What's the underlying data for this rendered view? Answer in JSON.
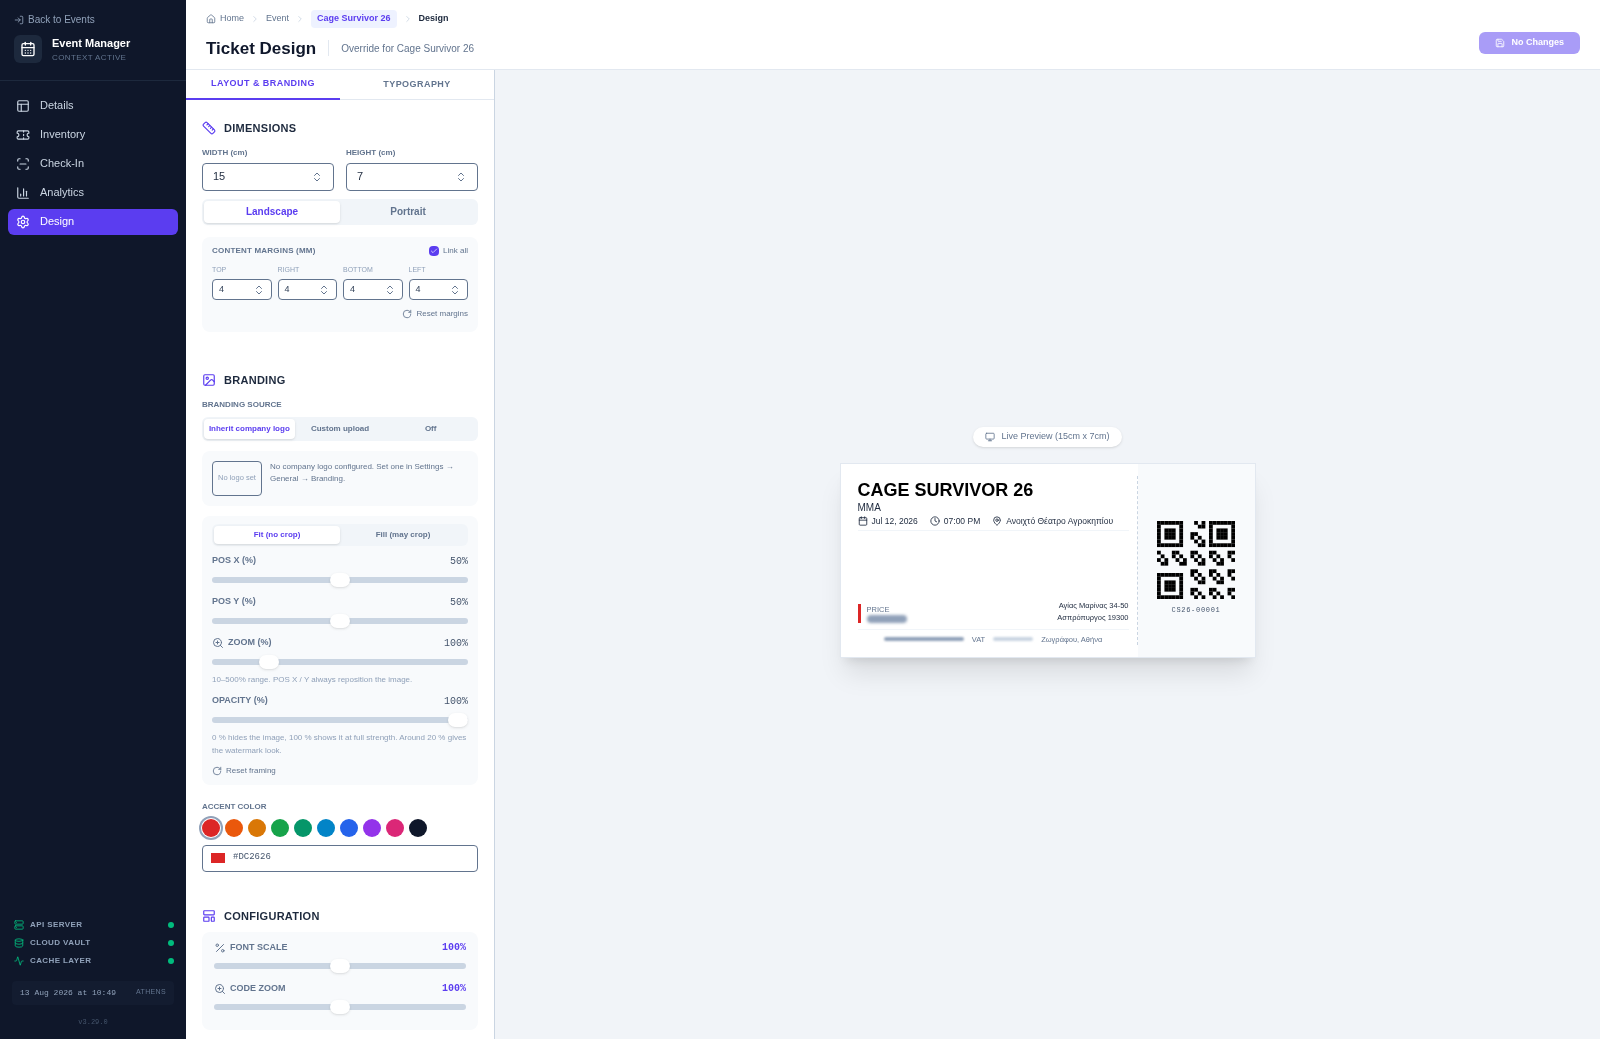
{
  "sidebar": {
    "back_link": "Back to Events",
    "app_title": "Event Manager",
    "app_subtitle": "CONTEXT ACTIVE",
    "nav": [
      {
        "label": "Details",
        "selected": false
      },
      {
        "label": "Inventory",
        "selected": false
      },
      {
        "label": "Check-In",
        "selected": false
      },
      {
        "label": "Analytics",
        "selected": false
      },
      {
        "label": "Design",
        "selected": true
      }
    ],
    "services": [
      {
        "label": "API SERVER",
        "online": true
      },
      {
        "label": "CLOUD VAULT",
        "online": true
      },
      {
        "label": "CACHE LAYER",
        "online": true
      }
    ],
    "clock": {
      "datetime": "13 Aug 2026 at 10:49",
      "city": "ATHENS"
    },
    "version": "v3.29.0"
  },
  "header": {
    "breadcrumbs": [
      {
        "label": "Home",
        "kind": "home"
      },
      {
        "label": "Event",
        "kind": "link"
      },
      {
        "label": "Cage Survivor 26",
        "kind": "highlight"
      },
      {
        "label": "Design",
        "kind": "current"
      }
    ],
    "title": "Ticket Design",
    "subtitle": "Override for Cage Survivor 26",
    "save_button": {
      "label": "No Changes",
      "disabled": true
    }
  },
  "tabs": [
    {
      "label": "LAYOUT & BRANDING",
      "selected": true
    },
    {
      "label": "TYPOGRAPHY",
      "selected": false
    }
  ],
  "dimensions": {
    "title": "DIMENSIONS",
    "fields": [
      {
        "label": "WIDTH (cm)",
        "value": "15"
      },
      {
        "label": "HEIGHT (cm)",
        "value": "7"
      }
    ],
    "orientation": [
      {
        "label": "Landscape",
        "selected": true
      },
      {
        "label": "Portrait",
        "selected": false
      }
    ],
    "margins": {
      "title": "CONTENT MARGINS (MM)",
      "link_all": {
        "label": "Link all",
        "checked": true
      },
      "fields": [
        {
          "label": "TOP",
          "value": "4"
        },
        {
          "label": "RIGHT",
          "value": "4"
        },
        {
          "label": "BOTTOM",
          "value": "4"
        },
        {
          "label": "LEFT",
          "value": "4"
        }
      ],
      "reset": "Reset margins"
    }
  },
  "branding": {
    "title": "BRANDING",
    "source_label": "BRANDING SOURCE",
    "sources": [
      {
        "label": "Inherit company logo",
        "selected": true
      },
      {
        "label": "Custom upload",
        "selected": false
      },
      {
        "label": "Off",
        "selected": false
      }
    ],
    "logo_placeholder": "No logo set",
    "message": "No company logo configured. Set one in Settings → General → Branding.",
    "fit_modes": [
      {
        "label": "Fit (no crop)",
        "selected": true
      },
      {
        "label": "Fill (may crop)",
        "selected": false
      }
    ],
    "sliders": [
      {
        "label": "POS X (%)",
        "value": "50%",
        "level": 0.5,
        "kind": "plain"
      },
      {
        "label": "POS Y (%)",
        "value": "50%",
        "level": 0.5,
        "kind": "plain"
      },
      {
        "label": "ZOOM (%)",
        "value": "100%",
        "level": 0.2,
        "kind": "zoom",
        "hint": "10–500% range. POS X / Y always reposition the image."
      },
      {
        "label": "OPACITY (%)",
        "value": "100%",
        "level": 1,
        "kind": "plain",
        "hint": "0 % hides the image, 100 % shows it at full strength. Around 20 % gives the watermark look."
      }
    ],
    "reset": "Reset framing",
    "accent": {
      "label": "ACCENT COLOR",
      "swatches": [
        {
          "color": "#dc2626",
          "selected": true
        },
        {
          "color": "#ea580c",
          "selected": false
        },
        {
          "color": "#d97706",
          "selected": false
        },
        {
          "color": "#16a34a",
          "selected": false
        },
        {
          "color": "#059669",
          "selected": false
        },
        {
          "color": "#0284c7",
          "selected": false
        },
        {
          "color": "#2563eb",
          "selected": false
        },
        {
          "color": "#9333ea",
          "selected": false
        },
        {
          "color": "#db2777",
          "selected": false
        },
        {
          "color": "#0f172a",
          "selected": false
        }
      ],
      "hex": "#DC2626"
    }
  },
  "configuration": {
    "title": "CONFIGURATION",
    "sliders": [
      {
        "label": "FONT SCALE",
        "value": "100%",
        "level": 0.5,
        "kind": "percent"
      },
      {
        "label": "CODE ZOOM",
        "value": "100%",
        "level": 0.5,
        "kind": "zoom"
      }
    ]
  },
  "preview": {
    "badge": "Live Preview (15cm x 7cm)",
    "ticket": {
      "title": "CAGE SURVIVOR 26",
      "category": "MMA",
      "date": "Jul 12, 2026",
      "time": "07:00 PM",
      "venue": "Ανοιχτό Θέατρο Αγροκηπίου",
      "price_label": "PRICE",
      "address": [
        "Αγίας Μαρίνας 34-50",
        "Ασπρόπυργος 19300"
      ],
      "vat_label": "VAT",
      "footer_city": "Ζωγράφου, Αθήνα",
      "code": "CS26-00001"
    }
  }
}
